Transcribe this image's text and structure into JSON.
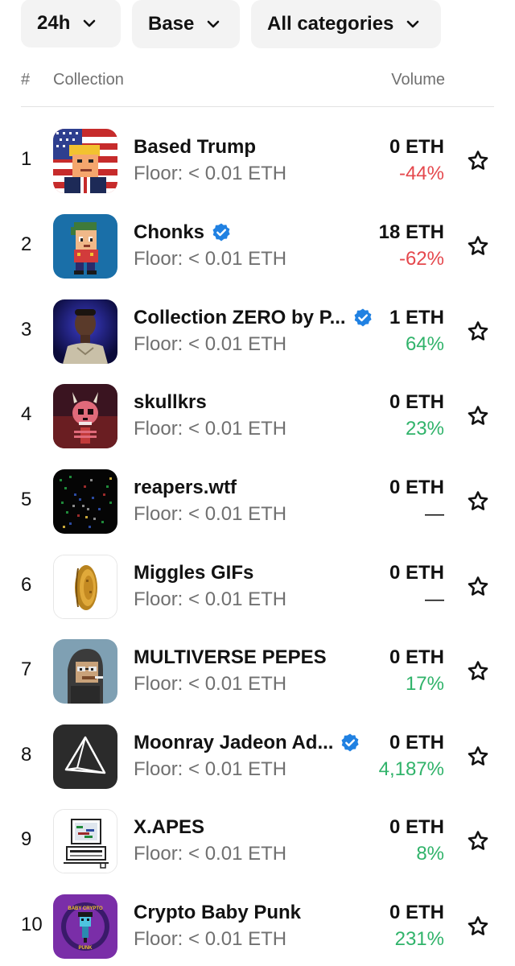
{
  "filters": [
    {
      "label": "24h"
    },
    {
      "label": "Base"
    },
    {
      "label": "All categories"
    }
  ],
  "table_header": {
    "rank": "#",
    "collection": "Collection",
    "volume": "Volume"
  },
  "rows": [
    {
      "rank": "1",
      "name": "Based Trump",
      "verified": false,
      "floor": "Floor: < 0.01 ETH",
      "volume": "0 ETH",
      "change": "-44%",
      "trend": "neg"
    },
    {
      "rank": "2",
      "name": "Chonks",
      "verified": true,
      "floor": "Floor: < 0.01 ETH",
      "volume": "18 ETH",
      "change": "-62%",
      "trend": "neg"
    },
    {
      "rank": "3",
      "name": "Collection ZERO by P...",
      "verified": true,
      "floor": "Floor: < 0.01 ETH",
      "volume": "1 ETH",
      "change": "64%",
      "trend": "pos"
    },
    {
      "rank": "4",
      "name": "skullkrs",
      "verified": false,
      "floor": "Floor: < 0.01 ETH",
      "volume": "0 ETH",
      "change": "23%",
      "trend": "pos"
    },
    {
      "rank": "5",
      "name": "reapers.wtf",
      "verified": false,
      "floor": "Floor: < 0.01 ETH",
      "volume": "0 ETH",
      "change": "—",
      "trend": "none"
    },
    {
      "rank": "6",
      "name": "Miggles GIFs",
      "verified": false,
      "floor": "Floor: < 0.01 ETH",
      "volume": "0 ETH",
      "change": "—",
      "trend": "none"
    },
    {
      "rank": "7",
      "name": "MULTIVERSE PEPES",
      "verified": false,
      "floor": "Floor: < 0.01 ETH",
      "volume": "0 ETH",
      "change": "17%",
      "trend": "pos"
    },
    {
      "rank": "8",
      "name": "Moonray Jadeon Ad...",
      "verified": true,
      "floor": "Floor: < 0.01 ETH",
      "volume": "0 ETH",
      "change": "4,187%",
      "trend": "pos"
    },
    {
      "rank": "9",
      "name": "X.APES",
      "verified": false,
      "floor": "Floor: < 0.01 ETH",
      "volume": "0 ETH",
      "change": "8%",
      "trend": "pos"
    },
    {
      "rank": "10",
      "name": "Crypto Baby Punk",
      "verified": false,
      "floor": "Floor: < 0.01 ETH",
      "volume": "0 ETH",
      "change": "231%",
      "trend": "pos"
    }
  ],
  "thumb_text": {
    "crypto_baby_punk_top": "BABY CRYPTO",
    "crypto_baby_punk_bottom": "PUNK"
  },
  "colors": {
    "negative": "#e5484d",
    "positive": "#30b36a",
    "verified": "#2081e2"
  }
}
